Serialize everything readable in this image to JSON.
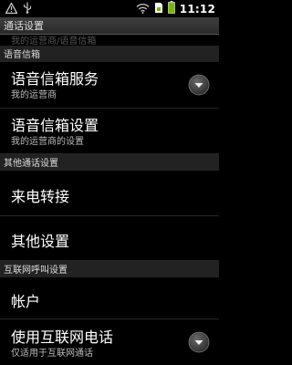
{
  "status_bar": {
    "time": "11:12",
    "icons": [
      "warning-icon",
      "usb-icon",
      "wifi-icon",
      "sim-icon",
      "battery-icon"
    ]
  },
  "title_bar": {
    "title": "通话设置"
  },
  "scroll_remnant": "我的运营商/语音信箱",
  "sections": {
    "voicemail": {
      "header": "语音信箱"
    },
    "other": {
      "header": "其他通话设置"
    },
    "internet": {
      "header": "互联网呼叫设置"
    }
  },
  "rows": {
    "voicemail_service": {
      "title": "语音信箱服务",
      "subtitle": "我的运营商"
    },
    "voicemail_settings": {
      "title": "语音信箱设置",
      "subtitle": "我的运营商的设置"
    },
    "call_forwarding": {
      "title": "来电转接"
    },
    "additional_settings": {
      "title": "其他设置"
    },
    "accounts": {
      "title": "帐户"
    },
    "use_internet_calling": {
      "title": "使用互联网电话",
      "subtitle": "仅适用于互联网通话"
    }
  },
  "colors": {
    "background": "#000000",
    "header_bg": "#222222",
    "text": "#ffffff",
    "subtext": "#bbbbbb"
  }
}
